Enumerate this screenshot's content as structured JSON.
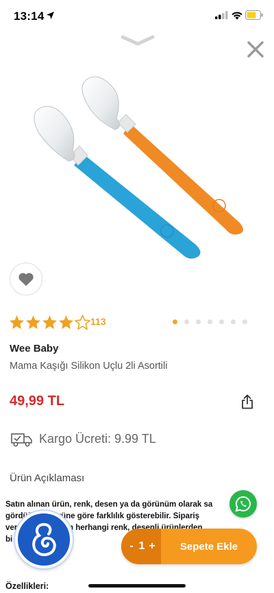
{
  "status_bar": {
    "time": "13:14"
  },
  "product": {
    "rating": 4.5,
    "review_count": "113",
    "brand": "Wee Baby",
    "name": "Mama Kaşığı Silikon Uçlu 2li Asortili",
    "price": "49,99 TL",
    "images_total": 7,
    "active_image": 1
  },
  "shipping": {
    "text": "Kargo Ücreti: 9.99 TL"
  },
  "description": {
    "title": "Ürün Açıklaması",
    "text": "Satın alınan ürün, renk, desen ya da görünüm olarak sa\ngördüğünüz ürüne göre farklılık gösterebilir. Sipariş\nver         nokta bulunan herhangi renk, desenli ürünlerden\nbi              ilecektir, renk              r."
  },
  "cart": {
    "minus": "-",
    "quantity": "1",
    "plus": "+",
    "add_label": "Sepete Ekle"
  },
  "features_label": "Özellikleri:",
  "colors": {
    "accent": "#f59a1e",
    "accent_dark": "#e07b0d",
    "price": "#d72a2a",
    "star": "#f0a11f",
    "whatsapp": "#29b74a",
    "logo_blue": "#1c5ac4"
  },
  "icons": {
    "location": "location-arrow-icon",
    "signal": "signal-icon",
    "wifi": "wifi-icon",
    "battery": "battery-icon",
    "collapse": "chevron-down-icon",
    "close": "close-icon",
    "favorite": "heart-icon",
    "share": "share-icon",
    "cargo": "truck-icon",
    "whatsapp": "whatsapp-icon",
    "app_logo": "wee-baby-logo"
  }
}
